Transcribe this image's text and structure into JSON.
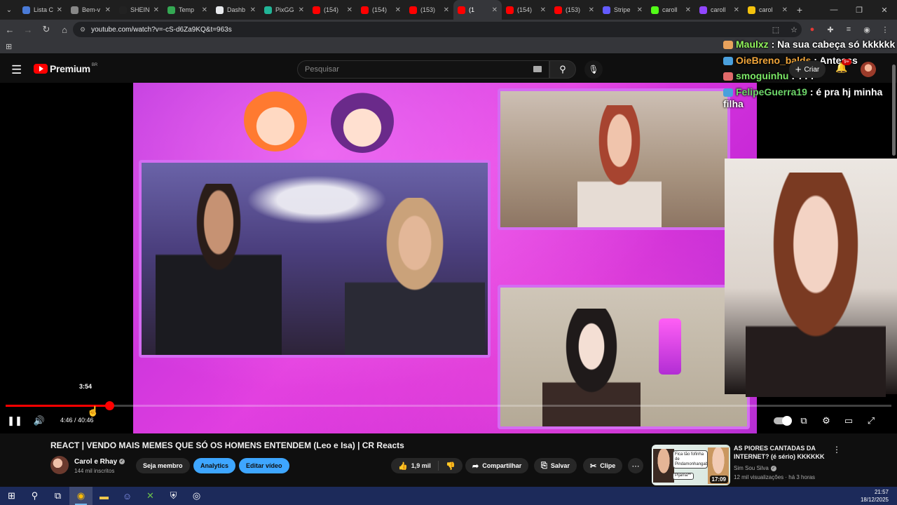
{
  "browser": {
    "tabs": [
      {
        "label": "Lista C",
        "color": "#4a7bd8",
        "active": false
      },
      {
        "label": "Bem-v",
        "color": "#888888",
        "active": false
      },
      {
        "label": "SHEIN",
        "color": "#222222",
        "active": false
      },
      {
        "label": "Temp",
        "color": "#34a853",
        "active": false
      },
      {
        "label": "Dashb",
        "color": "#e8eaed",
        "active": false
      },
      {
        "label": "PixGG",
        "color": "#21b597",
        "active": false
      },
      {
        "label": "(154)",
        "color": "#ff0000",
        "active": false
      },
      {
        "label": "(154)",
        "color": "#ff0000",
        "active": false
      },
      {
        "label": "(153)",
        "color": "#ff0000",
        "active": false
      },
      {
        "label": "(1",
        "color": "#ff0000",
        "active": true
      },
      {
        "label": "(154)",
        "color": "#ff0000",
        "active": false
      },
      {
        "label": "(153)",
        "color": "#ff0000",
        "active": false
      },
      {
        "label": "Stripe",
        "color": "#635bff",
        "active": false
      },
      {
        "label": "caroll",
        "color": "#53fc18",
        "active": false
      },
      {
        "label": "caroll",
        "color": "#9146ff",
        "active": false
      },
      {
        "label": "carol",
        "color": "#f4c20d",
        "active": false
      }
    ],
    "url": "youtube.com/watch?v=-cS-d6Za9KQ&t=963s"
  },
  "youtube": {
    "brand": "Premium",
    "region": "BR",
    "search_placeholder": "Pesquisar",
    "create_label": "Criar",
    "notifications": "9+"
  },
  "chat": [
    {
      "user": "Maulxz",
      "text": ": Na sua cabeça só kkkkkk",
      "badge": "b1",
      "ucls": "u1"
    },
    {
      "user": "OieBreno_balds",
      "text": ": Antesss",
      "badge": "b2",
      "ucls": "u2"
    },
    {
      "user": "smoguinhu",
      "text": ": ???",
      "badge": "b3",
      "ucls": "u3"
    },
    {
      "user": "FelipeGuerra19",
      "text": ": é pra hj minha filha",
      "badge": "b2",
      "ucls": "u4"
    }
  ],
  "player": {
    "preview_time": "3:54",
    "current_time": "4:46",
    "duration": "40:46",
    "time_display": "4:46 / 40:46",
    "progress_fraction": 0.117,
    "playing": true
  },
  "video": {
    "title": "REACT | VENDO MAIS MEMES QUE SÓ OS HOMENS ENTENDEM (Leo e Isa) | CR Reacts",
    "channel": "Carol e Rhay",
    "subscribers": "144 mil inscritos",
    "join_label": "Seja membro",
    "analytics_label": "Analytics",
    "edit_label": "Editar vídeo",
    "likes": "1,9 mil",
    "share_label": "Compartilhar",
    "save_label": "Salvar",
    "clip_label": "Clipe"
  },
  "recommendation": {
    "title": "AS PIORES CANTADAS DA INTERNET? (é sério) KKKKKK",
    "channel": "Sim Sou Silva",
    "views": "12 mil visualizações",
    "age": "há 3 horas",
    "meta": "12 mil visualizações · há 3 horas",
    "duration": "17:09",
    "thumb_text_1": "Fica tão fofinha de Pindamonhangaba",
    "thumb_text_2": "Pijama**"
  },
  "taskbar": {
    "time": "21:57",
    "date": "18/12/2025"
  }
}
